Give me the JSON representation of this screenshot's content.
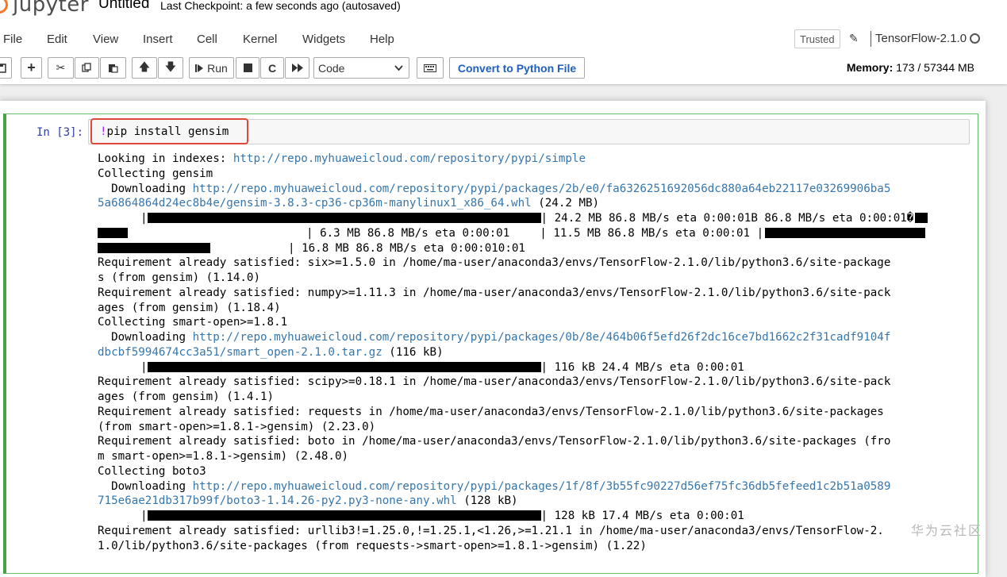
{
  "header": {
    "logo_text": "jupyter",
    "notebook_title": "Untitled",
    "checkpoint": "Last Checkpoint: a few seconds ago  (autosaved)"
  },
  "menu": [
    "File",
    "Edit",
    "View",
    "Insert",
    "Cell",
    "Kernel",
    "Widgets",
    "Help"
  ],
  "status": {
    "trusted": "Trusted",
    "kernel": "TensorFlow-2.1.0"
  },
  "toolbar": {
    "run_label": "Run",
    "cell_type": "Code",
    "convert_label": "Convert to Python File",
    "memory_label": "Memory:",
    "memory_value": "173 / 57344 MB"
  },
  "cell": {
    "prompt": "In [3]:",
    "code_bang": "!",
    "code_rest": "pip install gensim",
    "output": {
      "l1_text": "Looking in indexes: ",
      "l1_url": "http://repo.myhuaweicloud.com/repository/pypi/simple",
      "l2": "Collecting gensim",
      "l3_text": "  Downloading ",
      "l3_url": "http://repo.myhuaweicloud.com/repository/pypi/packages/2b/e0/fa6326251692056dc880a64eb22117e03269906ba5",
      "l4_url": "5a6864864d24ec8b4e/gensim-3.8.3-cp36-cp36m-manylinux1_x86_64.whl",
      "l4_text": " (24.2 MB)",
      "l5_text": "| 24.2 MB 86.8 MB/s eta 0:00:01B 86.8 MB/s eta 0:00:01�",
      "l6_a": "| 6.3 MB 86.8 MB/s eta 0:00:01",
      "l6_b": "| 11.5 MB 86.8 MB/s eta 0:00:01 |",
      "l7_text": "| 16.8 MB 86.8 MB/s eta 0:00:010:01",
      "l8": "Requirement already satisfied: six>=1.5.0 in /home/ma-user/anaconda3/envs/TensorFlow-2.1.0/lib/python3.6/site-package",
      "l9": "s (from gensim) (1.14.0)",
      "l10": "Requirement already satisfied: numpy>=1.11.3 in /home/ma-user/anaconda3/envs/TensorFlow-2.1.0/lib/python3.6/site-pack",
      "l11": "ages (from gensim) (1.18.4)",
      "l12": "Collecting smart-open>=1.8.1",
      "l13_text": "  Downloading ",
      "l13_url": "http://repo.myhuaweicloud.com/repository/pypi/packages/0b/8e/464b06f5efd26f2dc16ce7bd1662c2f31cadf9104f",
      "l14_url": "dbcbf5994674cc3a51/smart_open-2.1.0.tar.gz",
      "l14_text": " (116 kB)",
      "l15_text": "| 116 kB 24.4 MB/s eta 0:00:01",
      "l16": "Requirement already satisfied: scipy>=0.18.1 in /home/ma-user/anaconda3/envs/TensorFlow-2.1.0/lib/python3.6/site-pack",
      "l17": "ages (from gensim) (1.4.1)",
      "l18": "Requirement already satisfied: requests in /home/ma-user/anaconda3/envs/TensorFlow-2.1.0/lib/python3.6/site-packages",
      "l19": "(from smart-open>=1.8.1->gensim) (2.23.0)",
      "l20": "Requirement already satisfied: boto in /home/ma-user/anaconda3/envs/TensorFlow-2.1.0/lib/python3.6/site-packages (fro",
      "l21": "m smart-open>=1.8.1->gensim) (2.48.0)",
      "l22": "Collecting boto3",
      "l23_text": "  Downloading ",
      "l23_url": "http://repo.myhuaweicloud.com/repository/pypi/packages/1f/8f/3b55fc90227d56ef75fc36db5fefeed1c2b51a0589",
      "l24_url": "715e6ae21db317b99f/boto3-1.14.26-py2.py3-none-any.whl",
      "l24_text": " (128 kB)",
      "l25_text": "| 128 kB 17.4 MB/s eta 0:00:01",
      "l26": "Requirement already satisfied: urllib3!=1.25.0,!=1.25.1,<1.26,>=1.21.1 in /home/ma-user/anaconda3/envs/TensorFlow-2.",
      "l27": "1.0/lib/python3.6/site-packages (from requests->smart-open>=1.8.1->gensim) (1.22)"
    }
  },
  "watermark": "华为云社区"
}
